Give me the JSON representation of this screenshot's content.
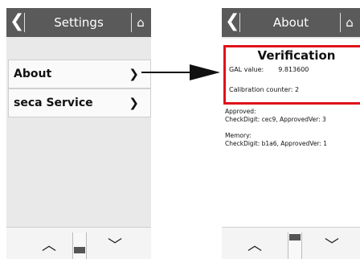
{
  "left_screen": {
    "header": {
      "back_glyph": "❮",
      "title": "Settings",
      "home_icon": "⌂"
    },
    "menu": [
      {
        "label": "About",
        "chevron": "❯"
      },
      {
        "label": "seca Service",
        "chevron": "❯"
      }
    ],
    "footer": {
      "up": "︿",
      "down": "﹀"
    }
  },
  "right_screen": {
    "header": {
      "back_glyph": "❮",
      "title": "About",
      "home_icon": "⌂"
    },
    "verification": {
      "title": "Verification",
      "gal_label": "GAL value:",
      "gal_value": "9.813600",
      "calibration": "Calibration counter: 2"
    },
    "approved": {
      "title": "Approved:",
      "detail": "CheckDigit: cec9, ApprovedVer: 3"
    },
    "memory": {
      "title": "Memory:",
      "detail": "CheckDigit: b1a6, ApprovedVer: 1"
    },
    "footer": {
      "up": "︿",
      "down": "﹀"
    }
  },
  "colors": {
    "header": "#5a5a5a",
    "highlight": "#e0131b"
  }
}
